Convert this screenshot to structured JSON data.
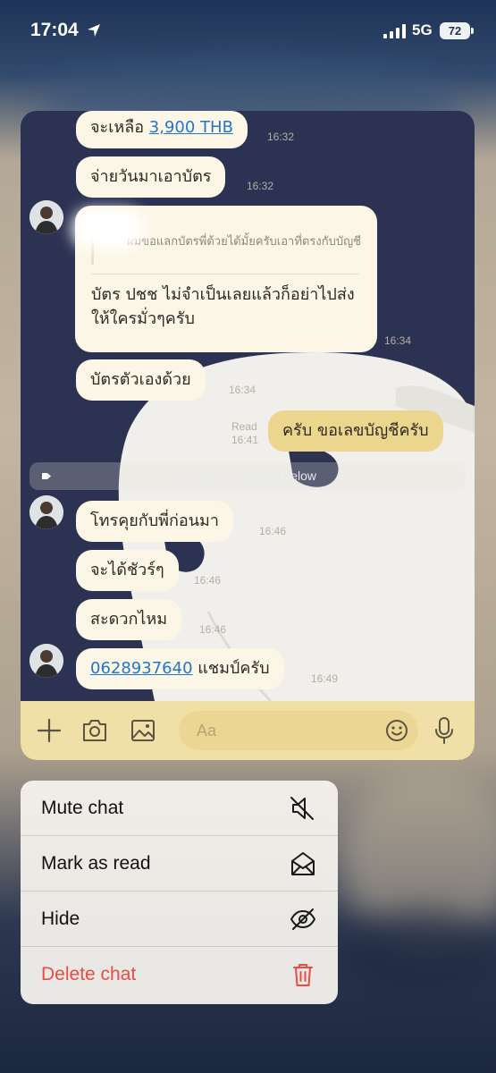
{
  "status_bar": {
    "time": "17:04",
    "network": "5G",
    "battery": "72"
  },
  "chat": {
    "messages": [
      {
        "text_prefix": "จะเหลือ ",
        "link": "3,900 THB",
        "time": "16:32"
      },
      {
        "text": "จ่ายวันมาเอาบัตร",
        "time": "16:32"
      },
      {
        "reply_quote": "ผมขอแลกบัตรพี่ด้วยได้มั้ยครับเอาที่ตรงกับบัญชี",
        "text": "บัตร ปชช ไม่จำเป็นเลยแล้วก็อย่าไปส่งให้ใครมั่วๆครับ",
        "time": "16:34"
      },
      {
        "text": "บัตรตัวเองด้วย",
        "time": "16:34"
      },
      {
        "read_label": "Read",
        "text": "ครับ ขอเลขบัญชีครับ",
        "time": "16:41"
      },
      {
        "text": "โทรคุยกับพี่ก่อนมา",
        "time": "16:46"
      },
      {
        "text": "จะได้ชัวร์ๆ",
        "time": "16:46"
      },
      {
        "text": "สะดวกไหม",
        "time": "16:46"
      },
      {
        "link": "0628937640",
        "text_suffix": " แชมป์ครับ",
        "time": "16:49"
      }
    ],
    "unread_divider": "Unread messages below",
    "input_placeholder": "Aa"
  },
  "menu": {
    "items": [
      {
        "label": "Mute chat",
        "icon": "mute-icon"
      },
      {
        "label": "Mark as read",
        "icon": "envelope-open-icon"
      },
      {
        "label": "Hide",
        "icon": "eye-slash-icon"
      },
      {
        "label": "Delete chat",
        "icon": "trash-icon"
      }
    ]
  },
  "colors": {
    "chat_background": "#2c3352",
    "incoming_bubble": "#fbf6e6",
    "outgoing_bubble": "#ecd58c",
    "input_bar": "#f0dfa6",
    "link": "#2277c9",
    "danger": "#eb4b43"
  }
}
